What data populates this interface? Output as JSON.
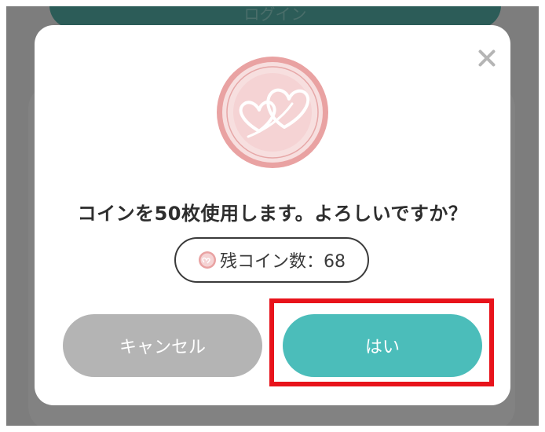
{
  "background": {
    "top_button_label": "ログイン"
  },
  "dialog": {
    "message": "コインを50枚使用します。よろしいですか？",
    "remaining_coins_label": "残コイン数：68",
    "cancel_label": "キャンセル",
    "confirm_label": "はい",
    "icons": {
      "close": "close-icon",
      "coin": "heart-coin-icon"
    },
    "colors": {
      "confirm_button": "#4bbdba",
      "cancel_button": "#b4b4b4",
      "highlight": "#e8131b"
    }
  }
}
